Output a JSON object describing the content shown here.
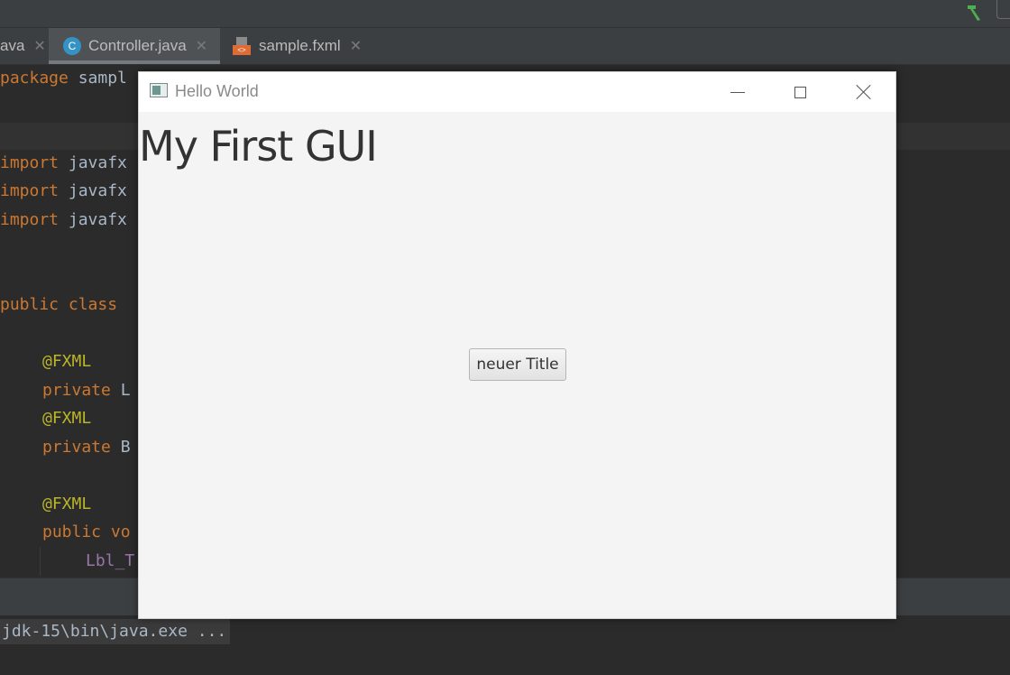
{
  "ide": {
    "tabs": [
      {
        "label": "ava",
        "active": false
      },
      {
        "label": "Controller.java",
        "active": true,
        "icon": "java-class-icon"
      },
      {
        "label": "sample.fxml",
        "active": false,
        "icon": "fxml-file-icon"
      }
    ],
    "tab_close_glyph": "✕",
    "code": {
      "l1_kw": "package ",
      "l1_rest": "sampl",
      "import_kw": "import ",
      "import_rest": "javafx",
      "l5_kw1": "public ",
      "l5_kw2": "class ",
      "ann": "@FXML",
      "priv_kw": "private ",
      "priv_rest1": "L",
      "priv_rest2": "B",
      "pub_kw": "public ",
      "pub_rest": "vo",
      "field": "Lbl_T"
    },
    "run_command": "jdk-15\\bin\\java.exe ..."
  },
  "fx_window": {
    "title": "Hello World",
    "heading": "My First GUI",
    "button_label": "neuer Title"
  },
  "colors": {
    "ide_bg": "#2b2b2b",
    "keyword": "#cc7832",
    "annotation": "#bbb529",
    "fx_bg": "#f4f4f4"
  }
}
